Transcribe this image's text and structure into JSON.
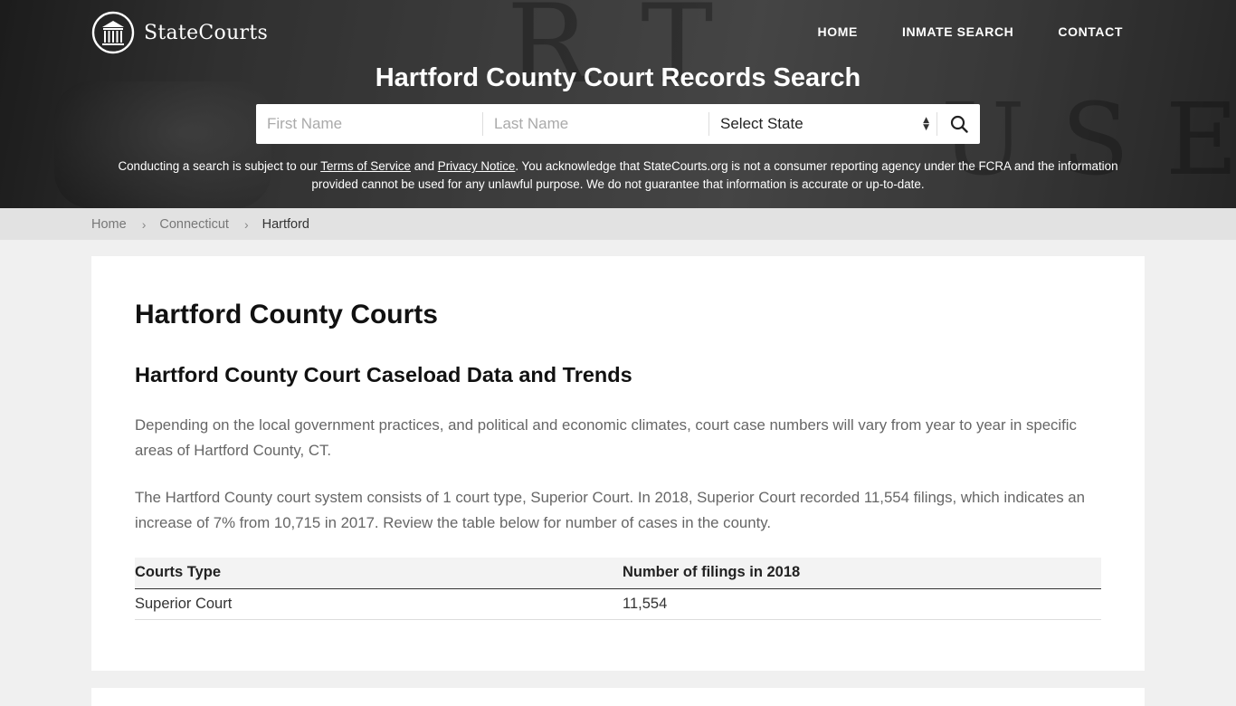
{
  "brand": {
    "name": "StateCourts"
  },
  "nav": {
    "items": [
      "HOME",
      "INMATE SEARCH",
      "CONTACT"
    ]
  },
  "hero": {
    "title": "Hartford County Court Records Search"
  },
  "search": {
    "first_name_placeholder": "First Name",
    "last_name_placeholder": "Last Name",
    "state_select": "Select State"
  },
  "disclaimer": {
    "before": "Conducting a search is subject to our ",
    "terms": "Terms of Service",
    "and": " and ",
    "privacy": "Privacy Notice",
    "after": ". You acknowledge that StateCourts.org is not a consumer reporting agency under the FCRA and the information provided cannot be used for any unlawful purpose. We do not guarantee that information is accurate or up-to-date."
  },
  "breadcrumb": {
    "home": "Home",
    "state": "Connecticut",
    "current": "Hartford"
  },
  "main": {
    "title": "Hartford County Courts",
    "section_title": "Hartford County Court Caseload Data and Trends",
    "para1": "Depending on the local government practices, and political and economic climates, court case numbers will vary from year to year in specific areas of Hartford County, CT.",
    "para2": "The Hartford County court system consists of 1 court type, Superior Court. In 2018, Superior Court recorded 11,554 filings, which indicates an increase of 7% from 10,715 in 2017. Review the table below for number of cases in the county.",
    "table": {
      "headers": [
        "Courts Type",
        "Number of filings in 2018"
      ],
      "rows": [
        [
          "Superior Court",
          "11,554"
        ]
      ]
    }
  }
}
